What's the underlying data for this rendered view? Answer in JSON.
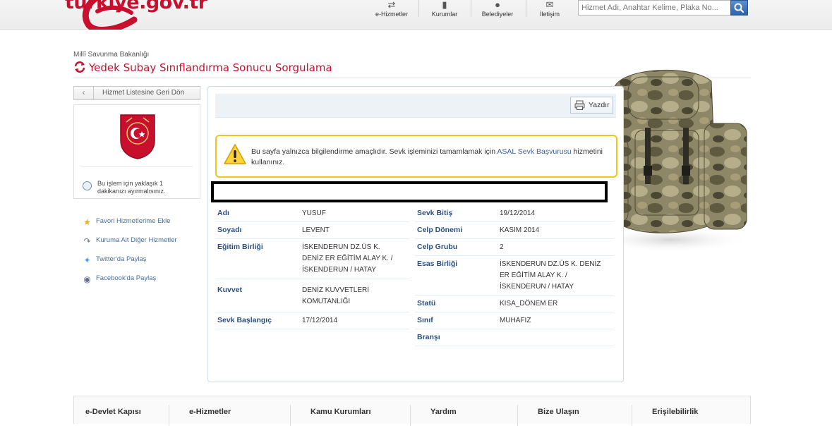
{
  "header": {
    "site_name": "türkiye.gov.tr",
    "nav": [
      {
        "label": "e-Hizmetler",
        "icon": "arrows-icon"
      },
      {
        "label": "Kurumlar",
        "icon": "book-icon"
      },
      {
        "label": "Belediyeler",
        "icon": "location-pin-icon"
      },
      {
        "label": "İletişim",
        "icon": "chat-icon"
      }
    ],
    "search_placeholder": "Hizmet Adı, Anahtar Kelime, Plaka No..."
  },
  "breadcrumb": {
    "ministry": "Millî Savunma Bakanlığı",
    "title": "Yedek Subay Sınıflandırma Sonucu Sorgulama"
  },
  "sidebar": {
    "back_label": "Hizmet Listesine Geri Dön",
    "time_note": "Bu işlem için yaklaşık 1 dakikanızı ayırmalısınız.",
    "links": [
      {
        "label": "Favori Hizmetlerime Ekle",
        "icon": "star-icon"
      },
      {
        "label": "Kuruma Ait Diğer Hizmetler",
        "icon": "redo-arrow-icon"
      },
      {
        "label": "Twitter'da Paylaş",
        "icon": "twitter-icon"
      },
      {
        "label": "Facebook'da Paylaş",
        "icon": "facebook-icon"
      }
    ]
  },
  "toolbar": {
    "print_label": "Yazdır"
  },
  "notice": {
    "text_before": "Bu sayfa yalnızca bilgilendirme amaçlıdır. Sevk işleminizi tamamlamak için ",
    "link": "ASAL Sevk Başvurusu",
    "text_after": " hizmetini kullanınız."
  },
  "record_left": [
    {
      "key": "Adı",
      "value": "YUSUF"
    },
    {
      "key": "Soyadı",
      "value": "LEVENT"
    },
    {
      "key": "Eğitim Birliği",
      "value": "İSKENDERUN DZ.ÜS K. DENİZ ER EĞİTİM ALAY K. / İSKENDERUN / HATAY"
    },
    {
      "key": "Kuvvet",
      "value": "DENİZ KUVVETLERİ KOMUTANLIĞI"
    },
    {
      "key": "Sevk Başlangıç",
      "value": "17/12/2014"
    }
  ],
  "record_right": [
    {
      "key": "Sevk Bitiş",
      "value": "19/12/2014"
    },
    {
      "key": "Celp Dönemi",
      "value": "KASIM 2014"
    },
    {
      "key": "Celp Grubu",
      "value": "2"
    },
    {
      "key": "Esas Birliği",
      "value": "İSKENDERUN DZ.ÜS K. DENİZ ER EĞİTİM ALAY K. / İSKENDERUN / HATAY"
    },
    {
      "key": "Statü",
      "value": "KISA_DÖNEM ER"
    },
    {
      "key": "Sınıf",
      "value": "MUHAFIZ"
    },
    {
      "key": "Branşı",
      "value": ""
    }
  ],
  "footer": [
    "e-Devlet Kapısı",
    "e-Hizmetler",
    "Kamu Kurumları",
    "Yardım",
    "Bize Ulaşın",
    "Erişilebilirlik"
  ],
  "colors": {
    "brand_red": "#c8102e",
    "label_blue": "#2d4f7c",
    "link_blue": "#3a63a8",
    "notice_border": "#f2c41e"
  }
}
